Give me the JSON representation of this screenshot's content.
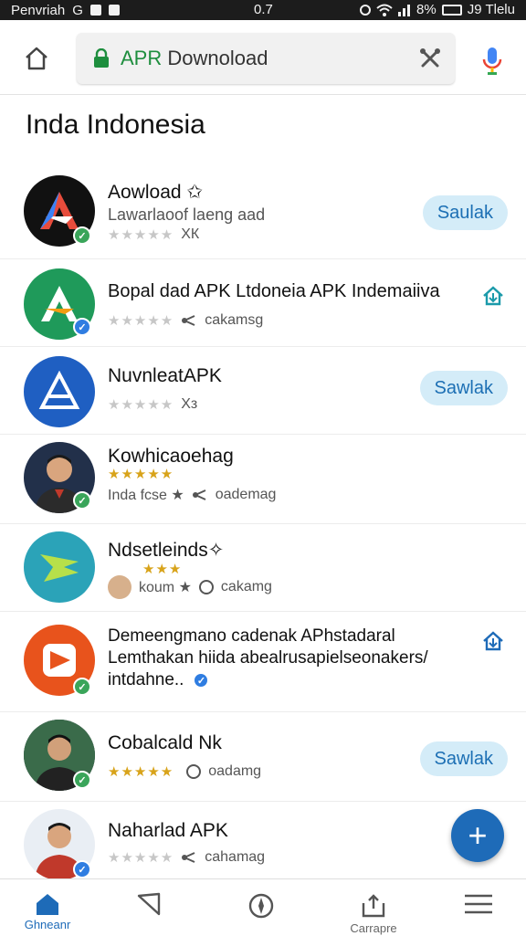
{
  "status_bar": {
    "left_text": "Penvriah",
    "left_icon_text": "G",
    "center_text": "0.7",
    "battery_text": "8%",
    "right_text": "J9 Tlelu"
  },
  "toolbar": {
    "url_https": "APR",
    "url_rest": "Downoload"
  },
  "page": {
    "title": "Inda Indonesia"
  },
  "apps": [
    {
      "name": "Aowload ✩",
      "subtitle": "Lawarlaoof laeng aad",
      "rating": 0,
      "meta": "ХК",
      "action": "Saulak",
      "action_type": "pill",
      "icon_bg": "#111111",
      "badge": "green"
    },
    {
      "name": "Bopal dad  APK Ltdoneia  APK Indemaiiva",
      "subtitle": "",
      "rating": 0,
      "meta": "cakamsg",
      "action": "",
      "action_type": "download",
      "icon_bg": "#1f9a5a",
      "badge": "blue"
    },
    {
      "name": "NuvnleatAPK",
      "subtitle": "",
      "rating": 0,
      "meta": "Хз",
      "action": "Sawlak",
      "action_type": "pill",
      "icon_bg": "#1f5fc2",
      "badge": ""
    },
    {
      "name": "Kowhicaoehag",
      "subtitle": "",
      "rating": 5,
      "meta_left": "Inda fcse ★",
      "meta": "oademag",
      "action": "",
      "action_type": "none",
      "icon_bg": "#22304a",
      "badge": "green"
    },
    {
      "name": "Ndsetleinds✧",
      "subtitle": "",
      "rating": 3,
      "meta_left": "koum ★",
      "meta": "cakamg",
      "action": "",
      "action_type": "none",
      "icon_bg": "#2ba3b8",
      "badge": ""
    },
    {
      "name": "Demeengmano cadenak APhstadaral",
      "subtitle": "Lemthakan hiida abealrusapielseonakers/",
      "subtitle2": "intdahne..",
      "rating": null,
      "meta": "",
      "action": "",
      "action_type": "download",
      "icon_bg": "#e8531c",
      "badge": "green"
    },
    {
      "name": "Cobalcald Nk",
      "subtitle": "",
      "rating": 5,
      "meta": "oadamg",
      "action": "Sawlak",
      "action_type": "pill",
      "icon_bg": "#1e2a38",
      "badge": "green"
    },
    {
      "name": "Naharlad APK",
      "subtitle": "",
      "rating": 0,
      "meta": "cahamag",
      "action": "",
      "action_type": "none",
      "icon_bg": "#c0392b",
      "badge": "blue"
    }
  ],
  "fab": {
    "label": "+"
  },
  "bottom_nav": [
    {
      "label": "Ghneanr",
      "icon": "home-icon",
      "active": true
    },
    {
      "label": "",
      "icon": "send-icon",
      "active": false
    },
    {
      "label": "",
      "icon": "compass-icon",
      "active": false
    },
    {
      "label": "Carrapre",
      "icon": "download-tray-icon",
      "active": false
    },
    {
      "label": "",
      "icon": "menu-icon",
      "active": false
    }
  ],
  "colors": {
    "accent": "#1e6bb8",
    "pill_bg": "#d4ecf8",
    "star": "#d8a31a",
    "status_bar": "#1c1c1c"
  }
}
